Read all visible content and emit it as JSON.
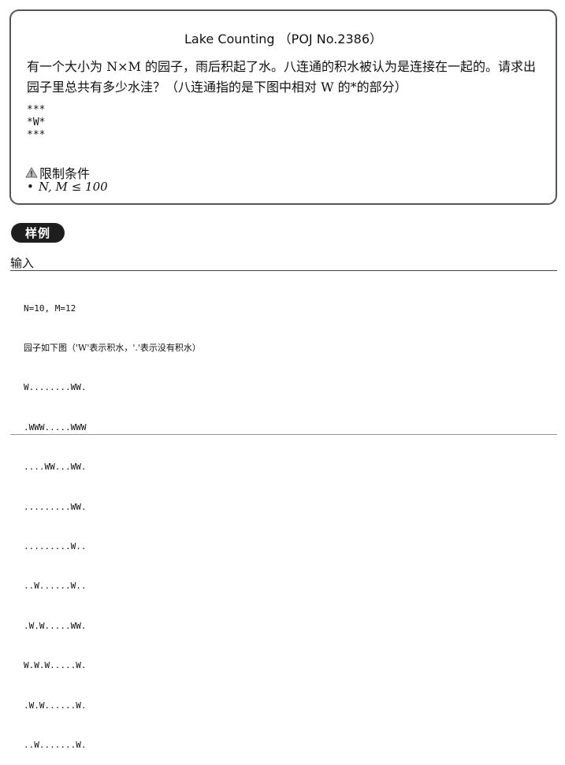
{
  "problem": {
    "title": "Lake Counting （POJ No.2386）",
    "statement_line1": "有一个大小为 N×M 的园子，雨后积起了水。八连通的积水被认为是连接在一起的。请求出",
    "statement_line2": "园子里总共有多少水洼？（八连通指的是下图中相对 W 的*的部分）",
    "pattern": [
      "***",
      "*W*",
      "***"
    ],
    "constraints_heading": "限制条件",
    "constraint_items": [
      "N, M ≤ 100"
    ]
  },
  "icons": {
    "constraints_icon": "warning-icon"
  },
  "sample": {
    "badge": "样例",
    "input_label": "输入",
    "input_lines": [
      "N=10, M=12",
      "园子如下图（'W'表示积水，'.'表示没有积水）",
      "W........WW.",
      ".WWW.....WWW",
      "....WW...WW.",
      ".........WW.",
      ".........W..",
      "..W......W..",
      ".W.W.....WW.",
      "W.W.W.....W.",
      ".W.W......W.",
      "..W.......W."
    ]
  }
}
